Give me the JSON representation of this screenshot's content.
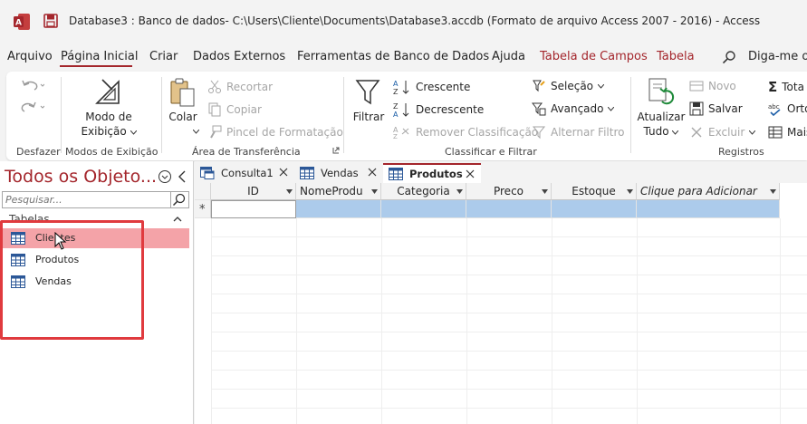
{
  "window": {
    "title": "Database3 : Banco de dados- C:\\Users\\Cliente\\Documents\\Database3.accdb (Formato de arquivo Access 2007 - 2016)  -  Access"
  },
  "menu": {
    "tabs": [
      {
        "label": "Arquivo"
      },
      {
        "label": "Página Inicial",
        "active": true
      },
      {
        "label": "Criar"
      },
      {
        "label": "Dados Externos"
      },
      {
        "label": "Ferramentas de Banco de Dados"
      },
      {
        "label": "Ajuda"
      },
      {
        "label": "Tabela de Campos",
        "context": true
      },
      {
        "label": "Tabela",
        "context": true
      }
    ],
    "tell_me": "Diga-me o"
  },
  "ribbon": {
    "groups": {
      "undo": "Desfazer",
      "views": "Modos de Exibição",
      "clipboard": "Área de Transferência",
      "sort_filter": "Classificar e Filtrar",
      "records": "Registros"
    },
    "view_button": {
      "line1": "Modo de",
      "line2": "Exibição"
    },
    "paste_button": "Colar",
    "cut": "Recortar",
    "copy": "Copiar",
    "format_painter": "Pincel de Formatação",
    "filter_button": "Filtrar",
    "ascending": "Crescente",
    "descending": "Decrescente",
    "remove_sort": "Remover Classificação",
    "selection": "Seleção",
    "advanced": "Avançado",
    "toggle_filter": "Alternar Filtro",
    "refresh_button": {
      "line1": "Atualizar",
      "line2": "Tudo"
    },
    "new": "Novo",
    "save": "Salvar",
    "delete": "Excluir",
    "totals": "Tota",
    "spelling": "Orto",
    "more": "Mais"
  },
  "nav": {
    "title": "Todos os Objeto...",
    "search_placeholder": "Pesquisar...",
    "section": "Tabelas",
    "items": [
      {
        "label": "Clientes",
        "selected": true
      },
      {
        "label": "Produtos"
      },
      {
        "label": "Vendas"
      }
    ]
  },
  "doctabs": [
    {
      "label": "Consulta1",
      "type": "query"
    },
    {
      "label": "Vendas",
      "type": "table"
    },
    {
      "label": "Produtos",
      "type": "table",
      "active": true
    }
  ],
  "datasheet": {
    "columns": [
      "ID",
      "NomeProdu",
      "Categoria",
      "Preco",
      "Estoque",
      "Clique para Adicionar"
    ],
    "new_row_marker": "*"
  },
  "colors": {
    "accent": "#a4262c",
    "selection": "#f4a3a8",
    "highlight_box": "#e03a3e",
    "new_row": "#accbeb"
  }
}
